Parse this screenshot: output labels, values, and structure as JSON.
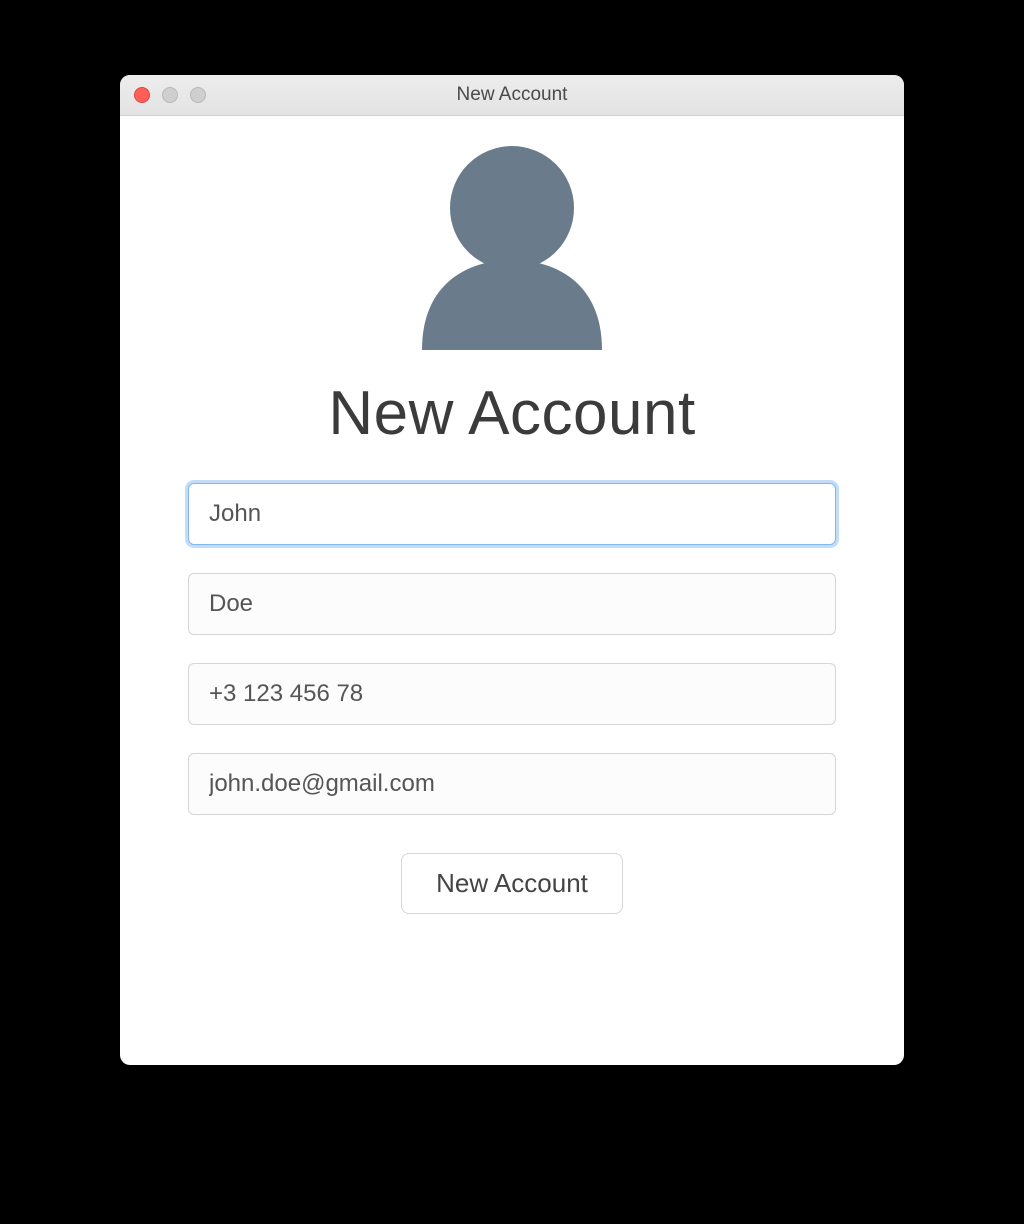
{
  "window": {
    "title": "New Account"
  },
  "form": {
    "heading": "New Account",
    "first_name": {
      "value": "John"
    },
    "last_name": {
      "value": "Doe"
    },
    "phone": {
      "value": "+3 123 456 78"
    },
    "email": {
      "value": "john.doe@gmail.com"
    },
    "submit_label": "New Account"
  },
  "colors": {
    "avatar_fill": "#6a7b8c",
    "focus_ring": "#529eec"
  }
}
